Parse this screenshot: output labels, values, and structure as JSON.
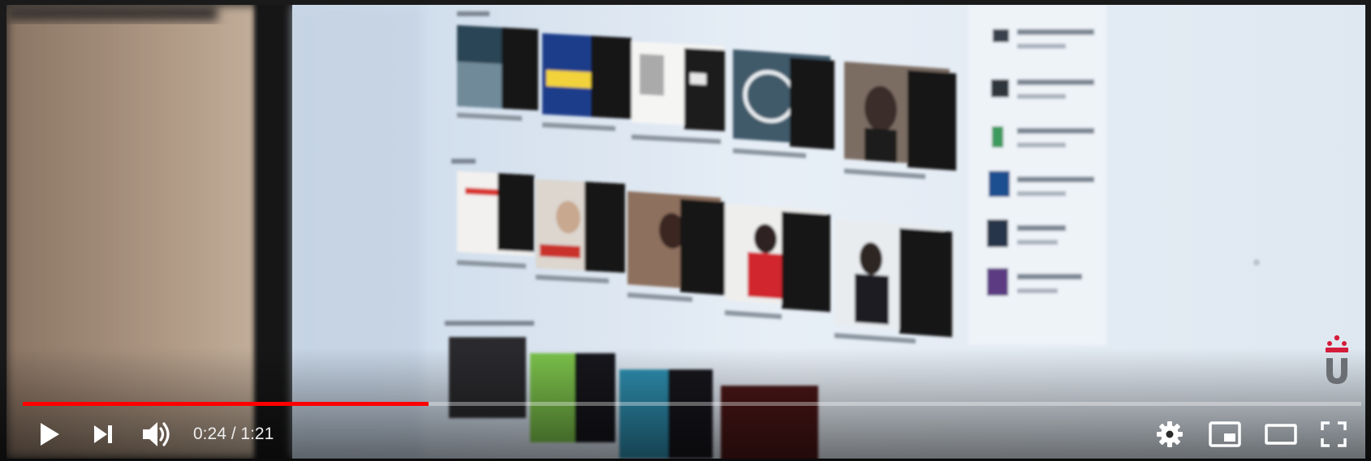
{
  "player": {
    "time": {
      "current": "0:24",
      "separator": " / ",
      "duration": "1:21"
    },
    "progress": {
      "played_fraction": 0.303
    },
    "accent_color": "#ff0000",
    "buttons": {
      "play": "play-icon",
      "next": "next-icon",
      "volume": "volume-icon",
      "settings": "gear-icon",
      "miniplayer": "miniplayer-icon",
      "theater": "theater-icon",
      "fullscreen": "fullscreen-icon"
    },
    "brand": "university-logo"
  }
}
